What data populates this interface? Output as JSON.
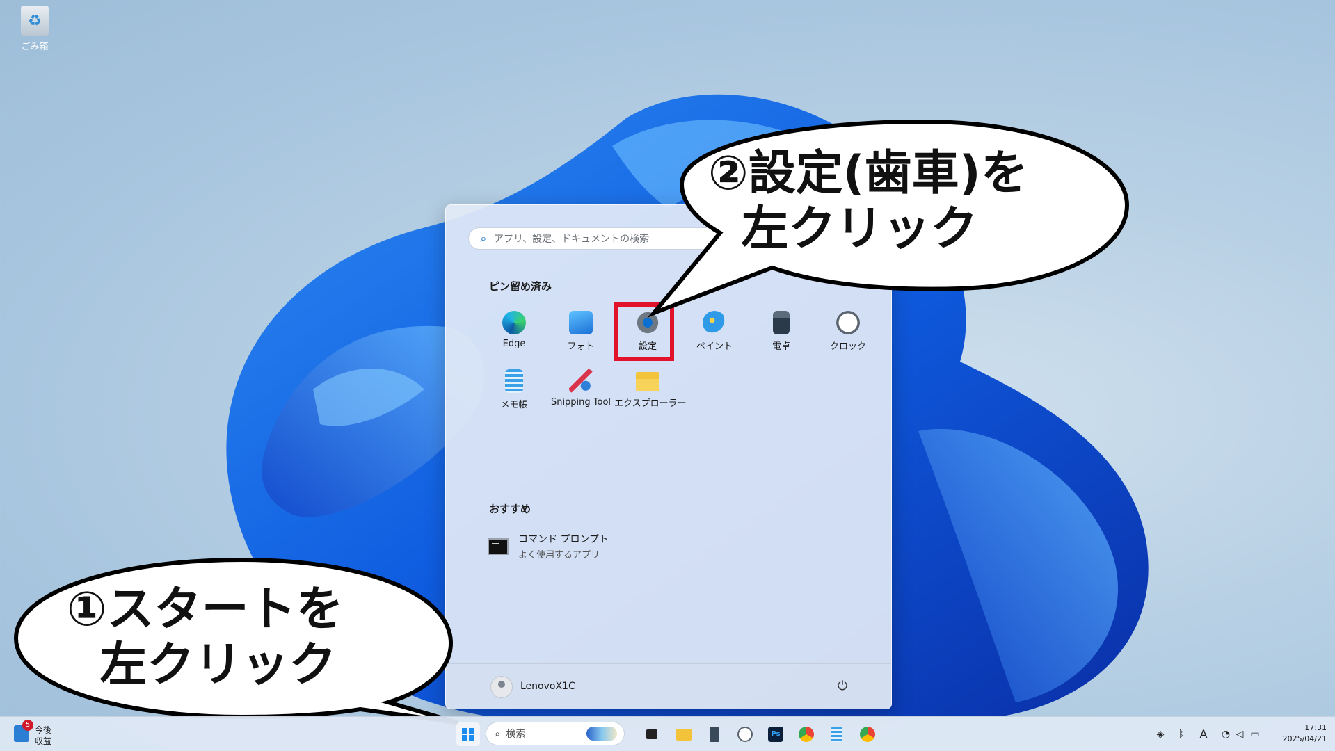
{
  "desktop": {
    "recycle_bin_label": "ごみ箱"
  },
  "start_menu": {
    "search_placeholder": "アプリ、設定、ドキュメントの検索",
    "pinned_title": "ピン留め済み",
    "pinned_apps": [
      {
        "label": "Edge",
        "icon": "edge-icon"
      },
      {
        "label": "フォト",
        "icon": "photos-icon"
      },
      {
        "label": "設定",
        "icon": "gear-icon"
      },
      {
        "label": "ペイント",
        "icon": "paint-icon"
      },
      {
        "label": "電卓",
        "icon": "calculator-icon"
      },
      {
        "label": "クロック",
        "icon": "clock-icon"
      },
      {
        "label": "メモ帳",
        "icon": "notepad-icon"
      },
      {
        "label": "Snipping Tool",
        "icon": "snipping-tool-icon"
      },
      {
        "label": "エクスプローラー",
        "icon": "folder-icon"
      }
    ],
    "recommended_title": "おすすめ",
    "recommended": [
      {
        "name": "コマンド プロンプト",
        "subtitle": "よく使用するアプリ",
        "icon": "command-prompt-icon"
      }
    ],
    "user_name": "LenovoX1C"
  },
  "taskbar": {
    "news_badge": "5",
    "news_line1": "今後",
    "news_line2": "収益",
    "search_label": "検索",
    "clock_time": "17:31",
    "clock_date": "2025/04/21",
    "ime_label": "A"
  },
  "callouts": {
    "start_instruction": "①スタートを\n  左クリック",
    "settings_instruction": "②設定(歯車)を\n  左クリック"
  },
  "colors": {
    "highlight": "#e1122a",
    "accent": "#0067c0",
    "windows_blue": "#1a8cf0"
  }
}
